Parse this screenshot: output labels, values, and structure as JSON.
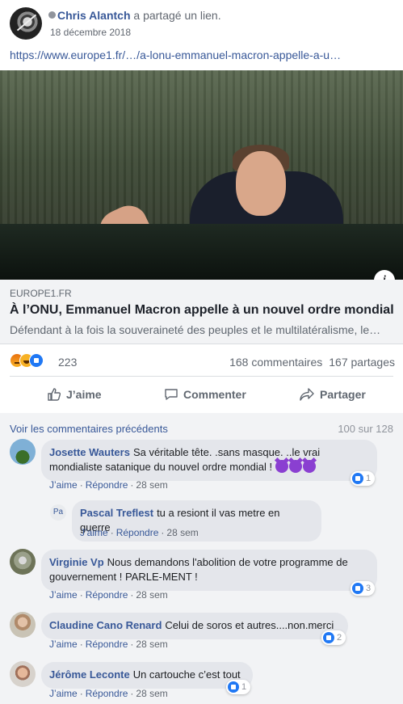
{
  "post": {
    "author": "Chris Alantch",
    "action": "a partagé un lien.",
    "date": "18 décembre 2018",
    "link": "https://www.europe1.fr/…/a-lonu-emmanuel-macron-appelle-a-u…"
  },
  "link_preview": {
    "domain": "EUROPE1.FR",
    "headline": "À l’ONU, Emmanuel Macron appelle à un nouvel ordre mondial",
    "description": "Défendant à la fois la souveraineté des peuples et le multilatéralisme, le…",
    "info_label": "i"
  },
  "engagement": {
    "reaction_count": "223",
    "comments": "168 commentaires",
    "shares": "167 partages"
  },
  "actions": {
    "like": "J’aime",
    "comment": "Commenter",
    "share": "Partager"
  },
  "comments_header": {
    "previous": "Voir les commentaires précédents",
    "count": "100 sur 128"
  },
  "comment_meta": {
    "like": "J’aime",
    "reply": "Répondre",
    "sep": "·"
  },
  "comments": [
    {
      "name": "Josette Wauters",
      "text_line1": "Sa véritable tête. .sans masque. ..le vrai",
      "text_line2": "mondialiste satanique du nouvel ordre mondial !",
      "time": "28 sem",
      "reactions": "1"
    },
    {
      "name": "Pascal Treflest",
      "avatar_initials": "Pa",
      "text": "tu a resiont il vas metre en guerre",
      "time": "28 sem"
    },
    {
      "name": "Virginie Vp",
      "text_line1": "Nous demandons l'abolition de votre programme de",
      "text_line2": "gouvernement ! PARLE-MENT !",
      "time": "28 sem",
      "reactions": "3"
    },
    {
      "name": "Claudine Cano Renard",
      "text": "Celui de soros et autres....non.merci",
      "time": "28 sem",
      "reactions": "2"
    },
    {
      "name": "Jérôme Leconte",
      "text": "Un cartouche c’est tout",
      "time": "28 sem",
      "reactions": "1"
    }
  ],
  "colors": {
    "link_blue": "#385898",
    "like_blue": "#2078f4",
    "muted": "#606770",
    "bubble": "#e4e6eb"
  }
}
